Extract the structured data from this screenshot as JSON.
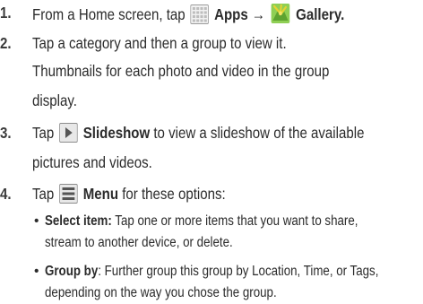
{
  "steps": [
    {
      "number": "1.",
      "line1": {
        "pre": "From a Home screen, tap",
        "apps_icon": "apps-grid-icon",
        "apps_label": "Apps",
        "arrow": "→",
        "gallery_icon": "gallery-icon",
        "gallery_label": "Gallery",
        "end": "."
      }
    },
    {
      "number": "2.",
      "line1": "Tap a category and then a group to view it.",
      "para_line1": "Thumbnails for each photo and video in the group",
      "para_line2": "display."
    },
    {
      "number": "3.",
      "line1": {
        "pre": "Tap",
        "slideshow_icon": "play-icon",
        "slideshow_label": "Slideshow",
        "post": "to view a slideshow of the available"
      },
      "line2": "pictures and videos."
    },
    {
      "number": "4.",
      "line1": {
        "pre": "Tap",
        "menu_icon": "menu-icon",
        "menu_label": "Menu",
        "post": "for these options:"
      },
      "bullets": [
        {
          "label": "Select item:",
          "line1": "Tap one or more items that you want to share,",
          "line2": "stream to another device, or delete."
        },
        {
          "label": "Group by",
          "line1": ": Further group this group by Location, Time, or Tags,",
          "line2": "depending on the way you chose the group."
        }
      ]
    }
  ],
  "colors": {
    "text": "#2b2b2b",
    "icon_gray": "#9a9a9a",
    "gallery_green": "#7cc242",
    "gallery_yellow": "#e7d233"
  }
}
